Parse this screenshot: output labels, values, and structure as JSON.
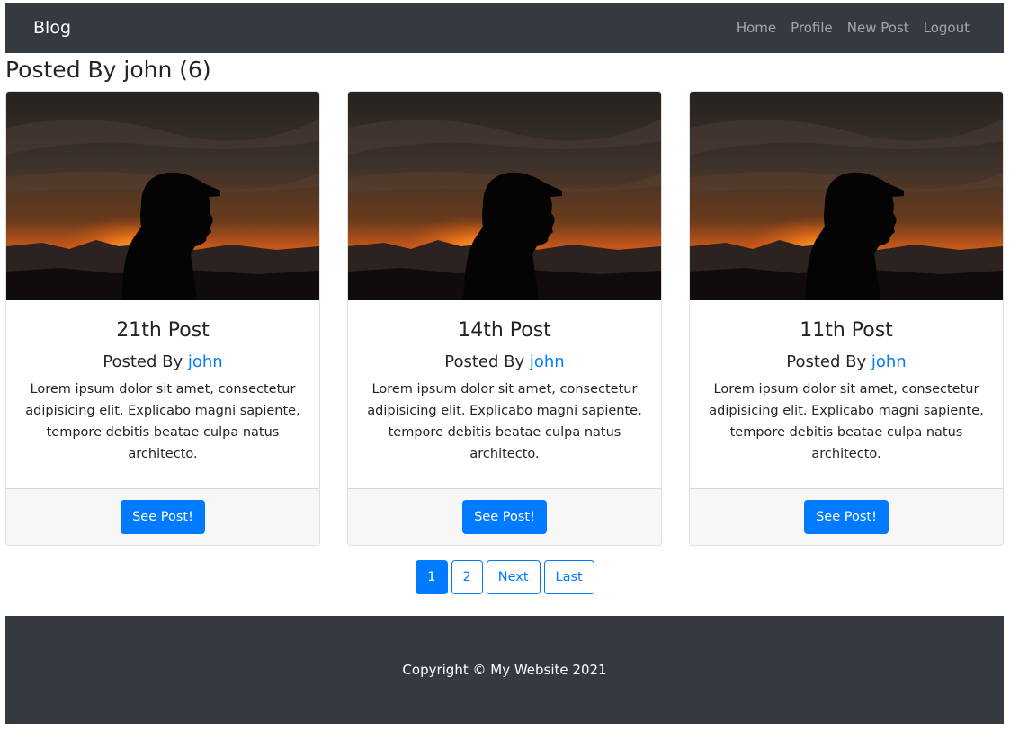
{
  "navbar": {
    "brand": "Blog",
    "links": [
      "Home",
      "Profile",
      "New Post",
      "Logout"
    ]
  },
  "page": {
    "title": "Posted By john (6)"
  },
  "posts": [
    {
      "title": "21th Post",
      "posted_by_prefix": "Posted By ",
      "author": "john",
      "text": "Lorem ipsum dolor sit amet, consectetur adipisicing elit. Explicabo magni sapiente, tempore debitis beatae culpa natus architecto.",
      "button": "See Post!"
    },
    {
      "title": "14th Post",
      "posted_by_prefix": "Posted By ",
      "author": "john",
      "text": "Lorem ipsum dolor sit amet, consectetur adipisicing elit. Explicabo magni sapiente, tempore debitis beatae culpa natus architecto.",
      "button": "See Post!"
    },
    {
      "title": "11th Post",
      "posted_by_prefix": "Posted By ",
      "author": "john",
      "text": "Lorem ipsum dolor sit amet, consectetur adipisicing elit. Explicabo magni sapiente, tempore debitis beatae culpa natus architecto.",
      "button": "See Post!"
    }
  ],
  "pagination": {
    "pages": [
      "1",
      "2",
      "Next",
      "Last"
    ],
    "active": "1"
  },
  "footer": {
    "text": "Copyright © My Website 2021"
  },
  "colors": {
    "navbar_bg": "#343a40",
    "primary": "#007bff",
    "card_footer_bg": "#f7f7f7"
  }
}
